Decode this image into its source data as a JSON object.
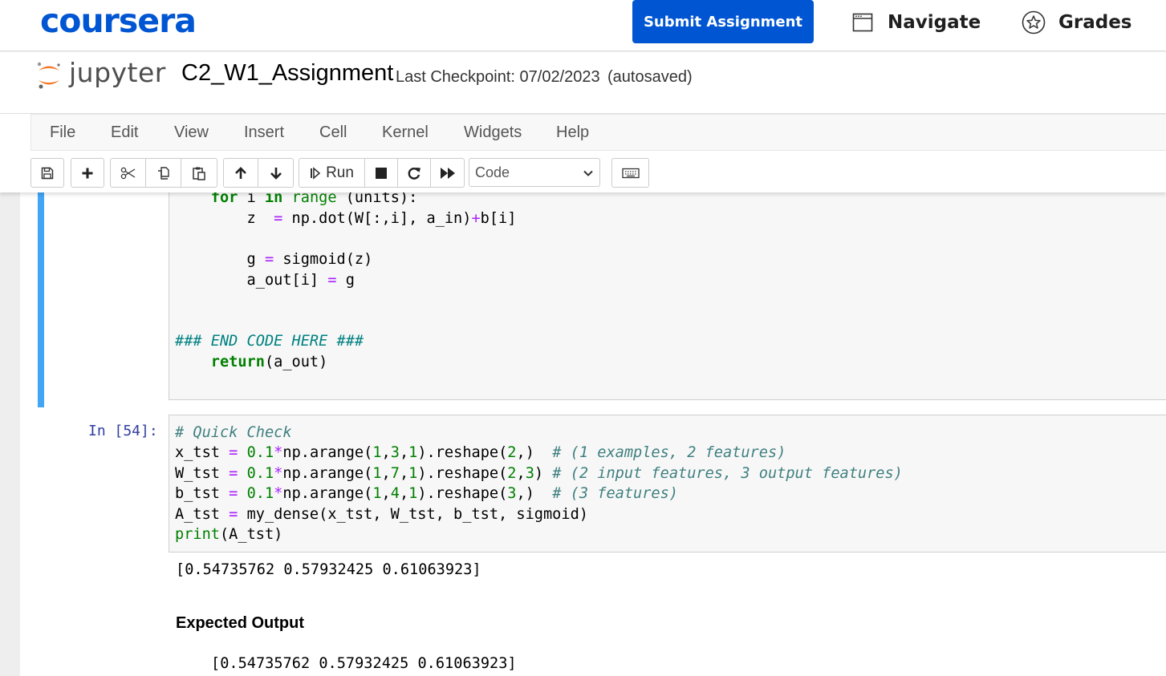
{
  "coursera": {
    "logo": "coursera",
    "submit_label": "Submit Assignment",
    "navigate_label": "Navigate",
    "grades_label": "Grades",
    "brand_color": "#0056d2"
  },
  "jupyter": {
    "logo_text": "jupyter",
    "notebook_title": "C2_W1_Assignment",
    "checkpoint": "Last Checkpoint: 07/02/2023",
    "autosave": "(autosaved)"
  },
  "menu": [
    "File",
    "Edit",
    "View",
    "Insert",
    "Cell",
    "Kernel",
    "Widgets",
    "Help"
  ],
  "toolbar": {
    "icons": [
      "save-icon",
      "plus-icon",
      "cut-icon",
      "copy-icon",
      "paste-icon",
      "arrow-up-icon",
      "arrow-down-icon",
      "run-icon",
      "stop-icon",
      "restart-icon",
      "fast-forward-icon",
      "keyboard-icon"
    ],
    "run_label": "Run",
    "cell_type": "Code"
  },
  "cell1": {
    "lines": [
      "    for i in range (units):",
      "        z  = np.dot(W[:,i], a_in)+b[i]",
      "",
      "        g = sigmoid(z)",
      "        a_out[i] = g",
      "",
      "",
      "### END CODE HERE ###",
      "    return(a_out)"
    ]
  },
  "cell2": {
    "prompt": "In [54]:",
    "lines": [
      "# Quick Check",
      "x_tst = 0.1*np.arange(1,3,1).reshape(2,)  # (1 examples, 2 features)",
      "W_tst = 0.1*np.arange(1,7,1).reshape(2,3) # (2 input features, 3 output features)",
      "b_tst = 0.1*np.arange(1,4,1).reshape(3,)  # (3 features)",
      "A_tst = my_dense(x_tst, W_tst, b_tst, sigmoid)",
      "print(A_tst)"
    ],
    "output": "[0.54735762 0.57932425 0.61063923]"
  },
  "expected": {
    "heading": "Expected Output",
    "value": "[0.54735762 0.57932425 0.61063923]"
  }
}
